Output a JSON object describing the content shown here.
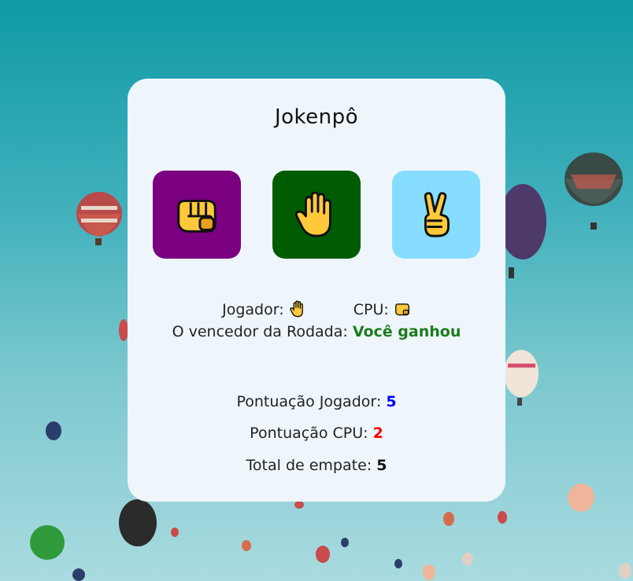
{
  "title": "Jokenpô",
  "choices": [
    {
      "name": "rock",
      "icon": "fist-icon",
      "color": "#7a0080"
    },
    {
      "name": "paper",
      "icon": "raised-hand-icon",
      "color": "#005c00"
    },
    {
      "name": "scissors",
      "icon": "victory-hand-icon",
      "color": "#86ddff"
    }
  ],
  "round": {
    "player_label": "Jogador:",
    "player_choice_icon": "raised-hand-icon",
    "cpu_label": "CPU:",
    "cpu_choice_icon": "fist-icon",
    "winner_label": "O vencedor da Rodada:",
    "winner_value": "Você ganhou",
    "winner_color": "#1c7a1c"
  },
  "scores": {
    "player_label": "Pontuação Jogador:",
    "player_value": "5",
    "player_color": "#0000ff",
    "cpu_label": "Pontuação CPU:",
    "cpu_value": "2",
    "cpu_color": "#ff0000",
    "ties_label": "Total de empate:",
    "ties_value": "5",
    "ties_color": "#111111"
  }
}
